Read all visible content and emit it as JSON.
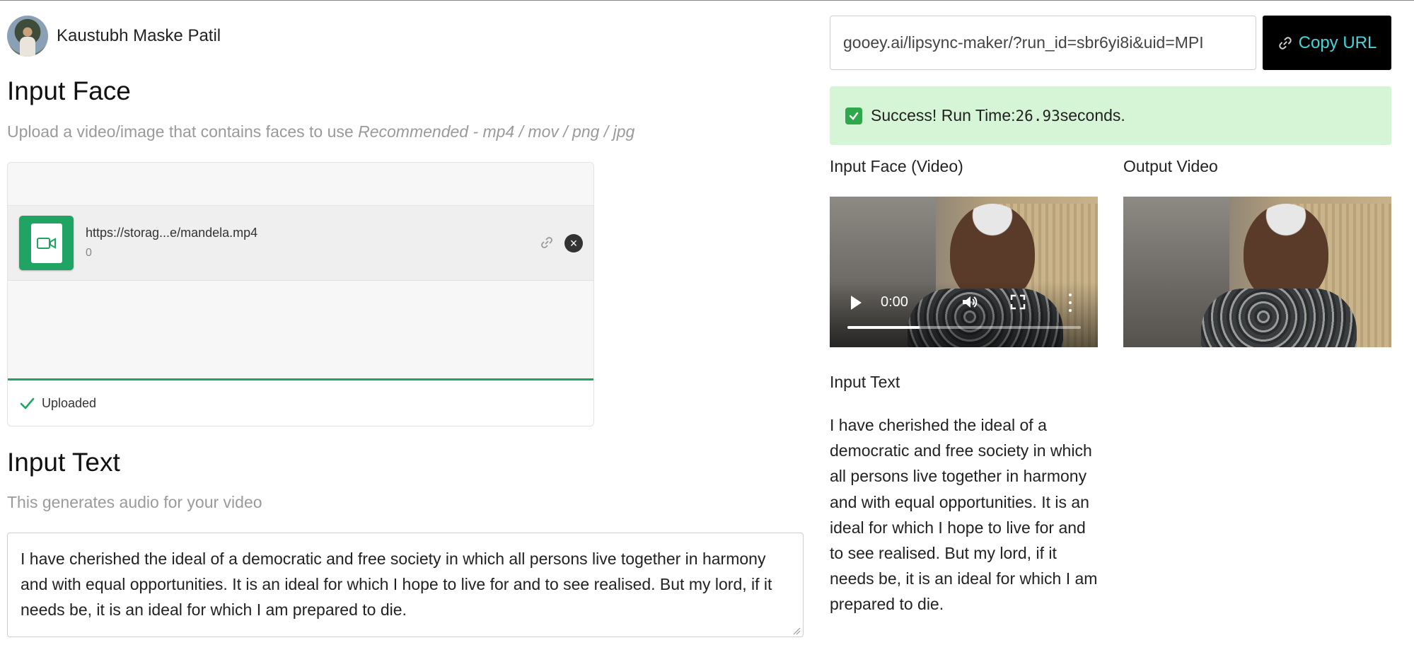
{
  "author": {
    "name": "Kaustubh Maske Patil"
  },
  "left": {
    "input_face": {
      "title": "Input Face",
      "description": "Upload a video/image that contains faces to use",
      "description_hint": "Recommended - mp4 / mov / png / jpg",
      "file": {
        "name": "https://storag...e/mandela.mp4",
        "size": "0"
      },
      "upload_status": "Uploaded",
      "progress": 1.0
    },
    "input_text": {
      "title": "Input Text",
      "description": "This generates audio for your video",
      "value": "I have cherished the ideal of a democratic and free society in which all persons live together in harmony and with equal opportunities. It is an ideal for which I hope to live for and to see realised. But my lord, if it needs be, it is an ideal for which I am prepared to die."
    }
  },
  "right": {
    "share_url": "gooey.ai/lipsync-maker/?run_id=sbr6yi8i&uid=MPI",
    "copy_button": "Copy URL",
    "success": {
      "prefix": "Success! Run Time: ",
      "seconds": "26.93",
      "suffix": " seconds."
    },
    "input_face_label": "Input Face (Video)",
    "output_video_label": "Output Video",
    "video_player": {
      "time": "0:00",
      "progress": 0.31
    },
    "input_text_label": "Input Text",
    "input_text_value": "I have cherished the ideal of a democratic and free society in which all persons live together in harmony and with equal opportunities. It is an ideal for which I hope to live for and to see realised. But my lord, if it needs be, it is an ideal for which I am prepared to die."
  },
  "colors": {
    "accent_green": "#1fa463",
    "success_bg": "#d6f5d6",
    "copy_text": "#46d4d8"
  }
}
